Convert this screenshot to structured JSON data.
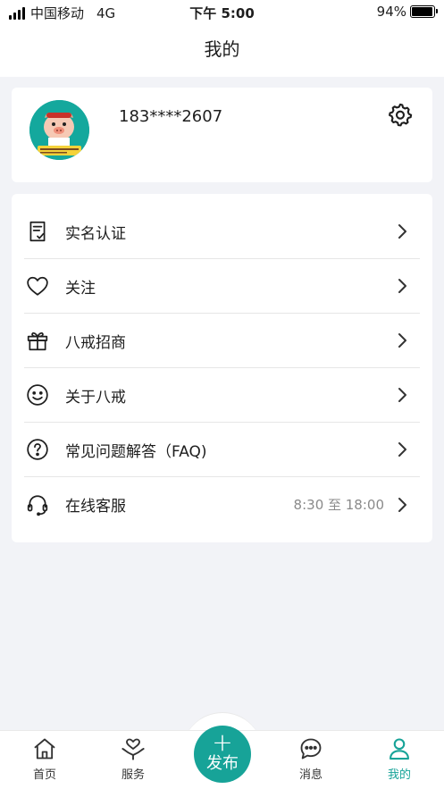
{
  "status_bar": {
    "carrier": "中国移动",
    "network": "4G",
    "time": "下午 5:00",
    "battery": "94%",
    "battery_level": 0.94
  },
  "nav": {
    "title": "我的"
  },
  "profile": {
    "phone": "183****2607",
    "avatar_icon": "pig-mascot-avatar",
    "settings_icon": "gear-icon"
  },
  "menu": {
    "items": [
      {
        "label": "实名认证",
        "icon": "id-document-icon",
        "extra": ""
      },
      {
        "label": "关注",
        "icon": "heart-icon",
        "extra": ""
      },
      {
        "label": "八戒招商",
        "icon": "gift-icon",
        "extra": ""
      },
      {
        "label": "关于八戒",
        "icon": "smiley-icon",
        "extra": ""
      },
      {
        "label": "常见问题解答（FAQ)",
        "icon": "question-icon",
        "extra": ""
      },
      {
        "label": "在线客服",
        "icon": "headset-icon",
        "extra": "8:30 至 18:00"
      }
    ]
  },
  "tabs": {
    "home": "首页",
    "service": "服务",
    "publish": "发布",
    "messages": "消息",
    "mine": "我的"
  },
  "colors": {
    "accent": "#17a398",
    "background": "#f2f3f7"
  }
}
